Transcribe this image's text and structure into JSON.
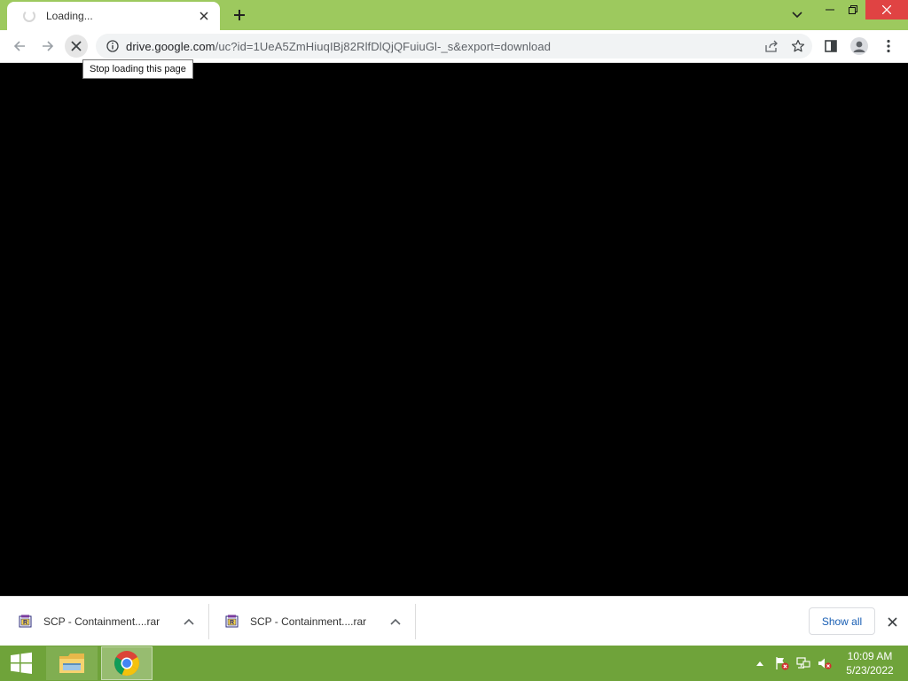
{
  "window": {
    "tab": {
      "title": "Loading..."
    },
    "controls": {
      "minimize": "–",
      "restore": "❐",
      "close": "✕"
    }
  },
  "toolbar": {
    "url_host": "drive.google.com",
    "url_path": "/uc?id=1UeA5ZmHiuqIBj82RlfDlQjQFuiuGl-_s&export=download",
    "tooltip": "Stop loading this page"
  },
  "downloads": {
    "items": [
      {
        "name": "SCP - Containment....rar",
        "icon": "winrar-archive-icon"
      },
      {
        "name": "SCP - Containment....rar",
        "icon": "winrar-archive-icon"
      }
    ],
    "show_all": "Show all"
  },
  "taskbar": {
    "apps": [
      "file-explorer",
      "google-chrome"
    ],
    "time": "10:09 AM",
    "date": "5/23/2022"
  },
  "colors": {
    "frame": "#9dc95e",
    "taskbar": "#6fa33a",
    "close_button": "#e04343",
    "content": "#000000"
  }
}
